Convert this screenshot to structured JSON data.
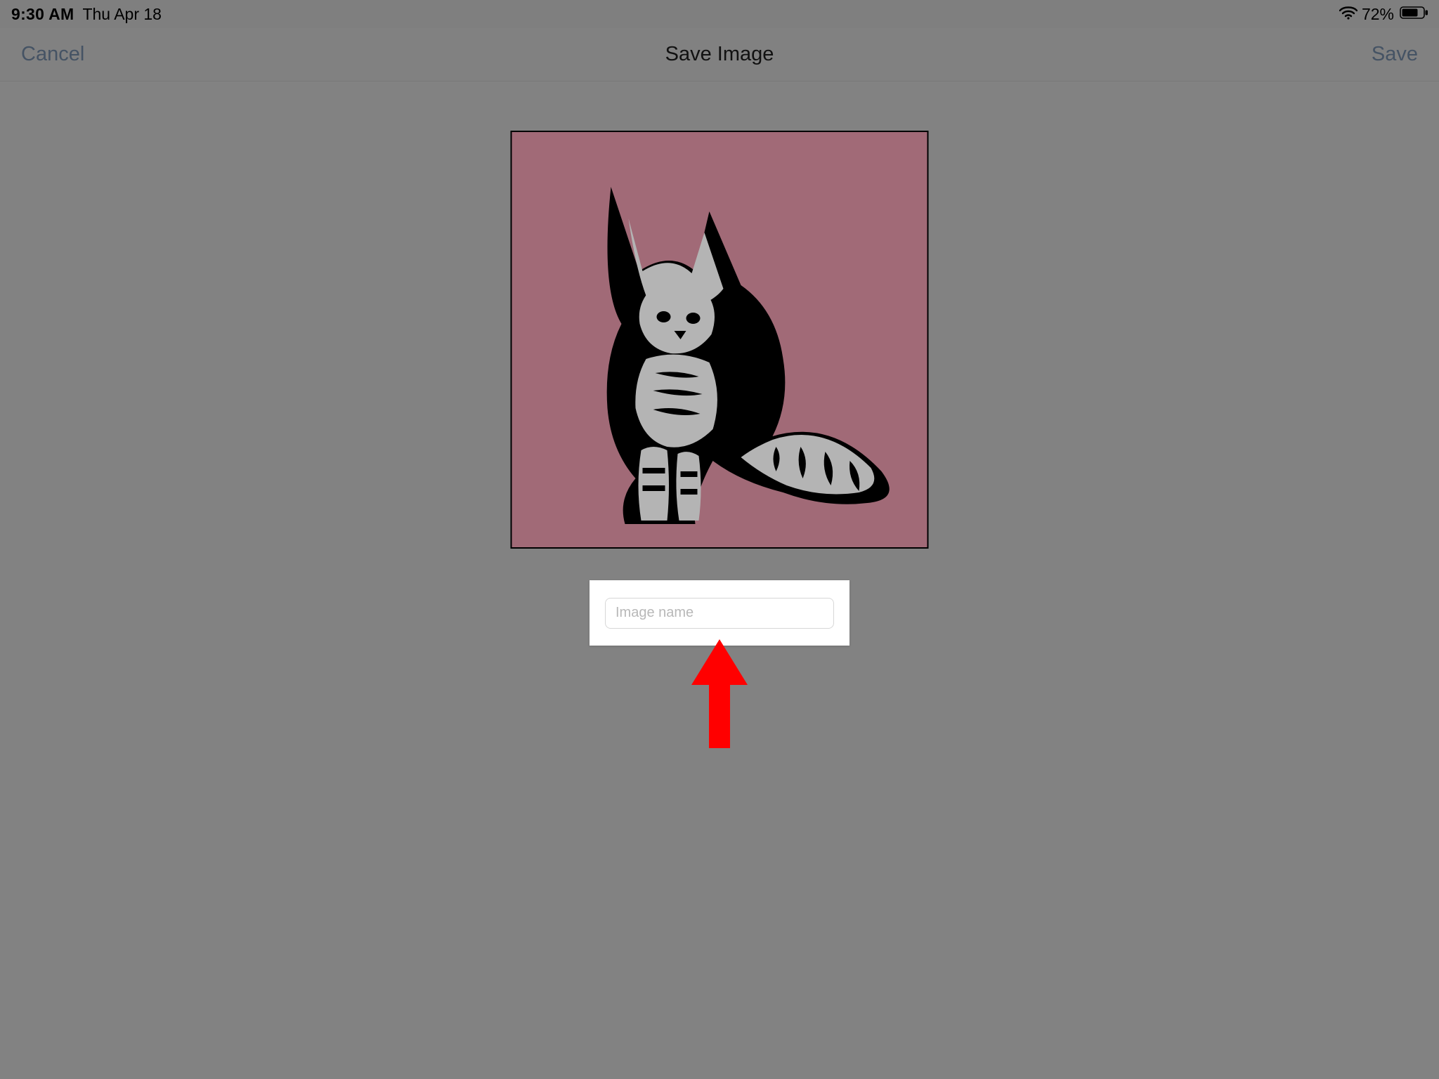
{
  "status_bar": {
    "time": "9:30 AM",
    "date": "Thu Apr 18",
    "battery_percent": "72%"
  },
  "nav": {
    "cancel_label": "Cancel",
    "title": "Save Image",
    "save_label": "Save"
  },
  "form": {
    "image_name_value": "",
    "image_name_placeholder": "Image name"
  },
  "preview": {
    "background_color": "#a16a77",
    "subject": "cat-illustration"
  },
  "annotation": {
    "arrow_color": "#ff0000"
  }
}
